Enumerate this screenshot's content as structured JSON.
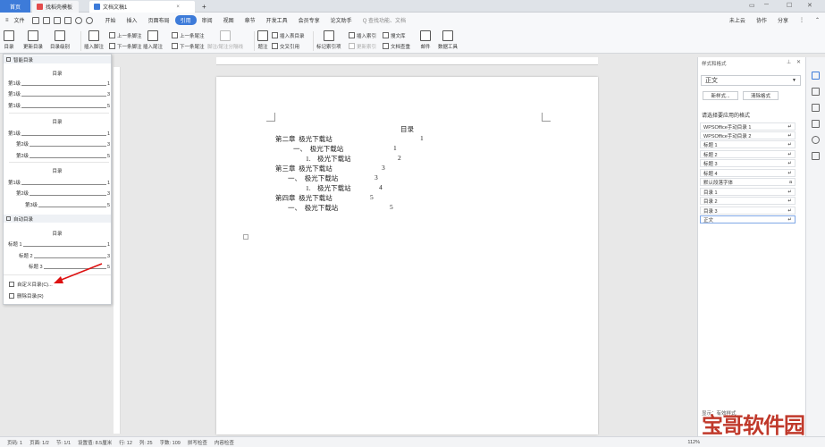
{
  "tabs": {
    "home": "首页",
    "template": "找稻壳模板",
    "document": "文档文稿1",
    "new_tab": "+"
  },
  "window": {
    "min": "─",
    "max": "☐",
    "close": "✕",
    "layout": "▭"
  },
  "menu": {
    "file": "文件",
    "items": [
      "开始",
      "插入",
      "页面布局",
      "引用",
      "审阅",
      "视图",
      "章节",
      "开发工具",
      "会员专享",
      "论文助手"
    ],
    "selected": "引用",
    "search_placeholder": "Q 查找功能、文档",
    "cloud": "未上云",
    "collab": "协作",
    "share": "分享"
  },
  "ribbon": {
    "toc": "目录",
    "update_toc": "更新目录",
    "toc_level": "目录级别",
    "insert_footnote": "插入脚注",
    "prev_footnote": "上一条脚注",
    "next_footnote": "下一条脚注",
    "insert_endnote": "插入尾注",
    "prev_endnote": "上一条尾注",
    "next_endnote": "下一条尾注",
    "footnote_sep": "脚注/尾注分隔线",
    "caption": "题注",
    "insert_table_toc": "插入表目录",
    "cross_ref": "交叉引用",
    "mark_index": "标记索引项",
    "insert_index": "插入索引",
    "update_index": "更新索引",
    "citation": "搜文库",
    "doc_check": "文档查重",
    "mail": "邮件",
    "data_tool": "数据工具"
  },
  "toc_panel": {
    "smart_header": "智能目录",
    "toc_title": "目录",
    "block1": [
      {
        "label": "第1级",
        "page": "1"
      },
      {
        "label": "第1级",
        "page": "3"
      },
      {
        "label": "第1级",
        "page": "5"
      }
    ],
    "block2": [
      {
        "label": "第1级",
        "page": "1"
      },
      {
        "label": "第2级",
        "page": "3"
      },
      {
        "label": "第2级",
        "page": "5"
      }
    ],
    "block3": [
      {
        "label": "第1级",
        "page": "1"
      },
      {
        "label": "第2级",
        "page": "3"
      },
      {
        "label": "第3级",
        "page": "5"
      }
    ],
    "auto_header": "自动目录",
    "auto": [
      {
        "label": "标题 1",
        "page": "1"
      },
      {
        "label": "标题 2",
        "page": "3"
      },
      {
        "label": "标题 3",
        "page": "5"
      }
    ],
    "custom": "自定义目录(C)...",
    "delete": "删除目录(R)"
  },
  "document": {
    "title": "目录",
    "lines": [
      {
        "text": "第二章  极光下载站",
        "page": "1"
      },
      {
        "text": "一、  极光下载站",
        "page": "1"
      },
      {
        "text": "1.    极光下载站",
        "page": "2"
      },
      {
        "text": "第三章  极光下载站",
        "page": "3"
      },
      {
        "text": "一、  极光下载站",
        "page": "3"
      },
      {
        "text": "1.    极光下载站",
        "page": "4"
      },
      {
        "text": "第四章  极光下载站",
        "page": "5"
      },
      {
        "text": "一、  极光下载站",
        "page": "5"
      }
    ]
  },
  "style_panel": {
    "header": "样式和格式",
    "current": "正文",
    "new_style": "新样式...",
    "clear_format": "清除格式",
    "choose_label": "请选择要应用的格式",
    "styles": [
      "WPSOffice手动目录 1",
      "WPSOffice手动目录 2",
      "标题 1",
      "标题 2",
      "标题 3",
      "标题 4",
      "默认段落字体",
      "目录 1",
      "目录 2",
      "目录 3",
      "正文"
    ],
    "display_label": "显示：有效样式"
  },
  "status": {
    "page": "页码: 1",
    "pages": "页面: 1/2",
    "section": "节: 1/1",
    "position": "设置值: 8.5厘米",
    "row": "行: 12",
    "col": "列: 25",
    "words": "字数: 109",
    "spell": "拼写检查",
    "content_check": "内容检查",
    "zoom": "112%"
  },
  "watermark": {
    "text": "宝哥软件园"
  }
}
